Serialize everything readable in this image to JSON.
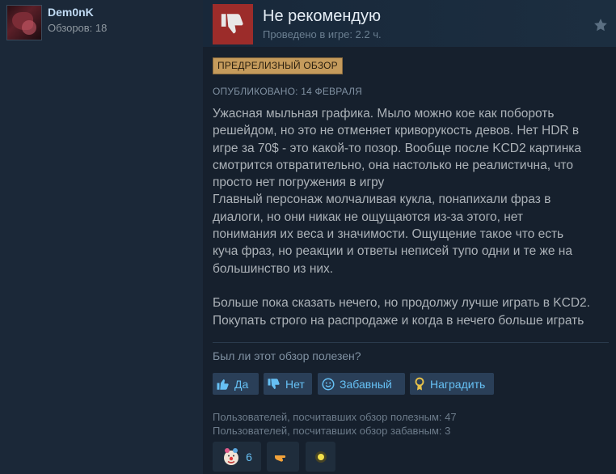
{
  "user": {
    "name": "Dem0nK",
    "reviews_label": "Обзоров: 18"
  },
  "review": {
    "verdict": "Не рекомендую",
    "hours": "Проведено в игре: 2.2 ч.",
    "badge": "ПРЕДРЕЛИЗНЫЙ ОБЗОР",
    "posted": "ОПУБЛИКОВАНО: 14 ФЕВРАЛЯ",
    "text": "Ужасная мыльная графика. Мыло можно кое как побороть\nрешейдом, но это не отменяет криворукость девов. Нет HDR в\nигре за 70$ - это какой-то позор. Вообще после KCD2 картинка\nсмотрится отвратительно, она настолько не реалистична, что\nпросто нет погружения в игру\nГлавный персонаж молчаливая кукла, понапихали фраз в\nдиалоги, но они никак не ощущаются из-за этого, нет\nпонимания их веса и значимости. Ощущение такое что есть\nкуча фраз, но реакции и ответы неписей тупо одни и те же на\nбольшинство из них.\n\nБольше пока сказать нечего, но продолжу лучше играть в KCD2.\nПокупать строго на распродаже и когда в нечего больше играть"
  },
  "helpful": {
    "question": "Был ли этот обзор полезен?",
    "yes_label": "Да",
    "no_label": "Нет",
    "funny_label": "Забавный",
    "award_label": "Наградить",
    "helpful_stat": "Пользователей, посчитавших обзор полезным: 47",
    "funny_stat": "Пользователей, посчитавших обзор забавным: 3"
  },
  "awards": [
    {
      "icon": "clown-face-icon",
      "count": "6"
    },
    {
      "icon": "pointing-hand-icon",
      "count": ""
    },
    {
      "icon": "glowing-orb-icon",
      "count": ""
    }
  ],
  "colors": {
    "background": "#1b2838",
    "panel": "#16202d",
    "thumb_down": "#9c2c2a",
    "badge": "#c59b5c",
    "link_blue": "#66c0f4"
  }
}
